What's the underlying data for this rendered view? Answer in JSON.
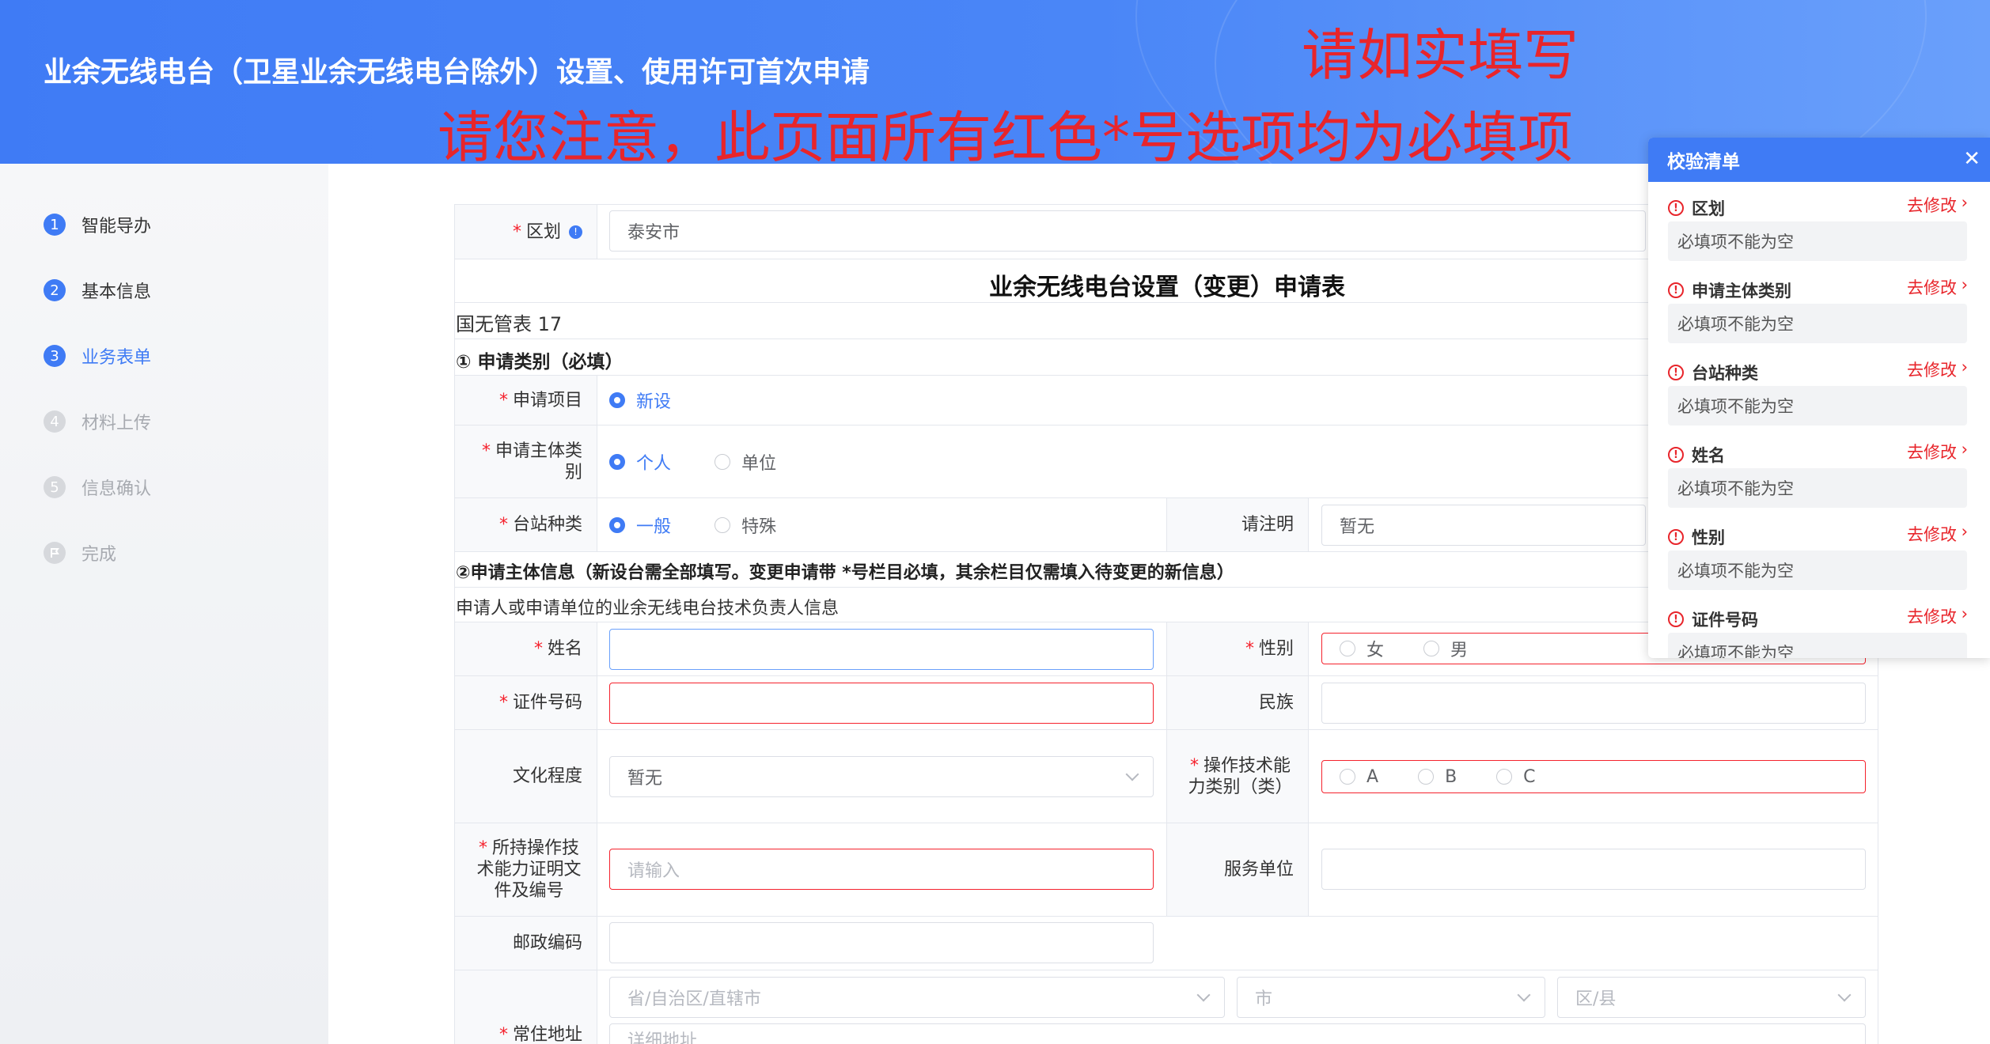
{
  "header": {
    "title": "业余无线电台（卫星业余无线电台除外）设置、使用许可首次申请"
  },
  "notes": {
    "top": "请如实填写",
    "warning": "请您注意，此页面所有红色*号选项均为必填项"
  },
  "sidebar": {
    "steps": [
      {
        "num": "1",
        "label": "智能导办"
      },
      {
        "num": "2",
        "label": "基本信息"
      },
      {
        "num": "3",
        "label": "业务表单"
      },
      {
        "num": "4",
        "label": "材料上传"
      },
      {
        "num": "5",
        "label": "信息确认"
      },
      {
        "num": "",
        "label": "完成"
      }
    ]
  },
  "form": {
    "region_label": "区划",
    "region_value": "泰安市",
    "form_title": "业余无线电台设置（变更）申请表",
    "form_code": "国无管表 17",
    "section1": "① 申请类别（必填）",
    "apply_item_label": "申请项目",
    "apply_item_option": "新设",
    "subject_type_label": "申请主体类别",
    "subject_type_options": [
      "个人",
      "单位"
    ],
    "station_type_label": "台站种类",
    "station_type_options": [
      "一般",
      "特殊"
    ],
    "specify_label": "请注明",
    "specify_value": "暂无",
    "section2": "②申请主体信息（新设台需全部填写。变更申请带 *号栏目必填，其余栏目仅需填入待变更的新信息）",
    "section2_desc": "申请人或申请单位的业余无线电台技术负责人信息",
    "name_label": "姓名",
    "gender_label": "性别",
    "gender_options": [
      "女",
      "男"
    ],
    "id_label": "证件号码",
    "ethnic_label": "民族",
    "education_label": "文化程度",
    "education_value": "暂无",
    "op_level_label": "操作技术能力类别（类）",
    "op_level_options": [
      "A",
      "B",
      "C"
    ],
    "cert_label": "所持操作技术能力证明文件及编号",
    "cert_placeholder": "请输入",
    "service_label": "服务单位",
    "postal_label": "邮政编码",
    "address_label": "常住地址",
    "province_placeholder": "省/自治区/直辖市",
    "city_placeholder": "市",
    "district_placeholder": "区/县",
    "detail_placeholder": "详细地址"
  },
  "validation": {
    "title": "校验清单",
    "fix_label": "去修改",
    "items": [
      {
        "field": "区划",
        "msg": "必填项不能为空"
      },
      {
        "field": "申请主体类别",
        "msg": "必填项不能为空"
      },
      {
        "field": "台站种类",
        "msg": "必填项不能为空"
      },
      {
        "field": "姓名",
        "msg": "必填项不能为空"
      },
      {
        "field": "性别",
        "msg": "必填项不能为空"
      },
      {
        "field": "证件号码",
        "msg": "必填项不能为空"
      }
    ]
  },
  "colors": {
    "primary": "#3f7bf5",
    "error": "#e8252b"
  }
}
